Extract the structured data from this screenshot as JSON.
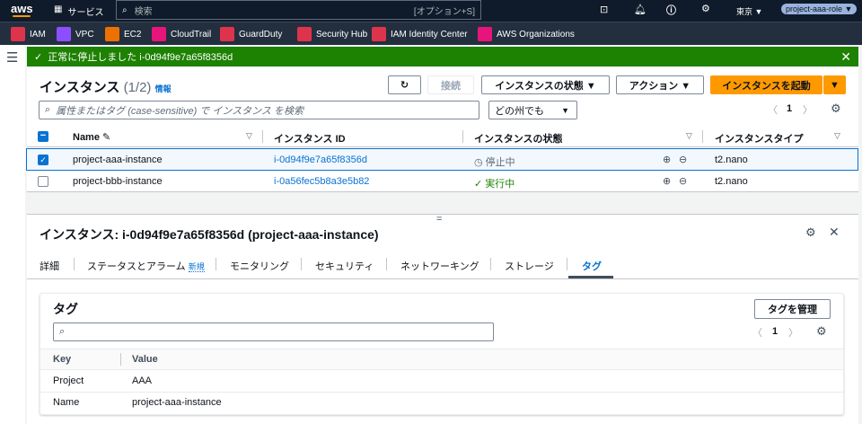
{
  "topbar": {
    "logo": "aws",
    "services": "サービス",
    "search_placeholder": "検索",
    "search_shortcut": "[オプション+S]",
    "region": "東京 ▼",
    "role": "project-aaa-role ▼"
  },
  "favorites": [
    {
      "label": "IAM",
      "color": "#dd344c"
    },
    {
      "label": "VPC",
      "color": "#8c4fff"
    },
    {
      "label": "EC2",
      "color": "#ed7100"
    },
    {
      "label": "CloudTrail",
      "color": "#e7157b"
    },
    {
      "label": "GuardDuty",
      "color": "#dd344c"
    },
    {
      "label": "Security Hub",
      "color": "#dd344c"
    },
    {
      "label": "IAM Identity Center",
      "color": "#dd344c"
    },
    {
      "label": "AWS Organizations",
      "color": "#e7157b"
    }
  ],
  "flash": {
    "message": "正常に停止しました i-0d94f9e7a65f8356d",
    "color": "#1d8102"
  },
  "instances": {
    "title": "インスタンス",
    "count": "(1/2)",
    "info": "情報",
    "connect": "接続",
    "state_btn": "インスタンスの状態 ▼",
    "action_btn": "アクション ▼",
    "launch_btn": "インスタンスを起動",
    "search_placeholder": "属性またはタグ (case-sensitive) で インスタンス を検索",
    "region_filter": "どの州でも",
    "page": "1",
    "columns": [
      "Name",
      "インスタンス ID",
      "インスタンスの状態",
      "インスタンスタイプ"
    ],
    "rows": [
      {
        "name": "project-aaa-instance",
        "id": "i-0d94f9e7a65f8356d",
        "state": "停止中",
        "type": "t2.nano",
        "selected": true
      },
      {
        "name": "project-bbb-instance",
        "id": "i-0a56fec5b8a3e5b82",
        "state": "実行中",
        "type": "t2.nano",
        "selected": false
      }
    ]
  },
  "detail": {
    "handle": "=",
    "title": "インスタンス: i-0d94f9e7a65f8356d (project-aaa-instance)",
    "tabs": [
      "詳細",
      "ステータスとアラーム",
      "モニタリング",
      "セキュリティ",
      "ネットワーキング",
      "ストレージ",
      "タグ"
    ],
    "new_badge": "新規",
    "tags": {
      "title": "タグ",
      "manage": "タグを管理",
      "page": "1",
      "columns": [
        "Key",
        "Value"
      ],
      "rows": [
        {
          "key": "Project",
          "value": "AAA"
        },
        {
          "key": "Name",
          "value": "project-aaa-instance"
        }
      ]
    }
  }
}
